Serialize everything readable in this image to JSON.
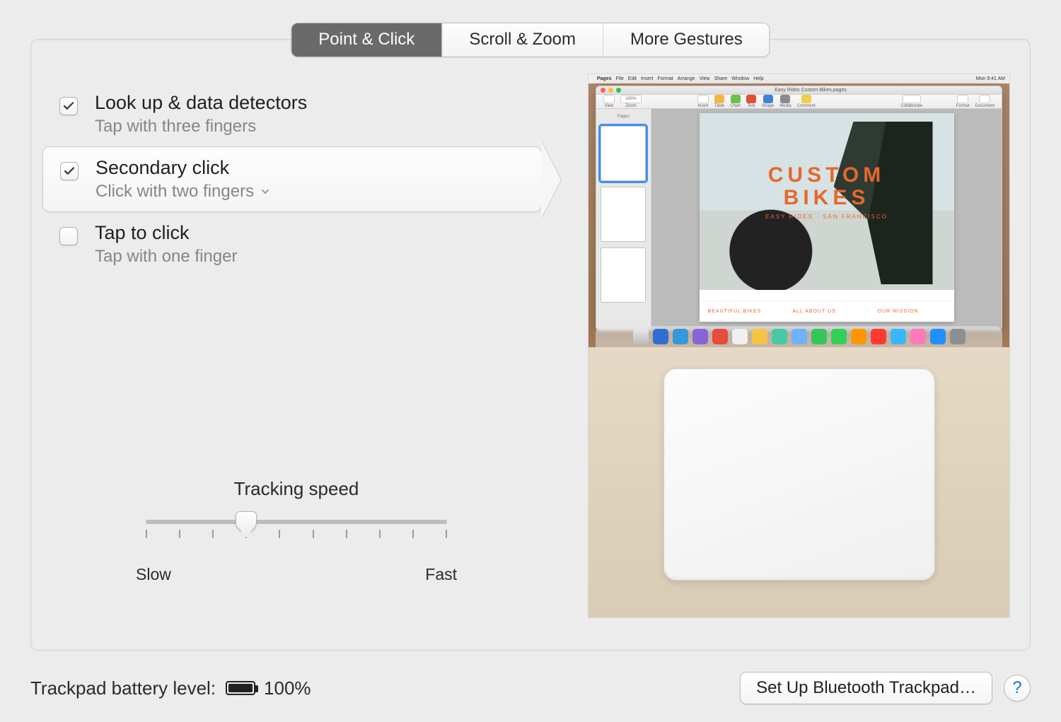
{
  "tabs": {
    "point": "Point & Click",
    "scroll": "Scroll & Zoom",
    "gestures": "More Gestures"
  },
  "options": {
    "lookup": {
      "title": "Look up & data detectors",
      "sub": "Tap with three fingers",
      "checked": true
    },
    "secondary": {
      "title": "Secondary click",
      "sub": "Click with two fingers",
      "checked": true
    },
    "tap": {
      "title": "Tap to click",
      "sub": "Tap with one finger",
      "checked": false
    }
  },
  "tracking": {
    "label": "Tracking speed",
    "slow": "Slow",
    "fast": "Fast",
    "ticks": 10,
    "value_index": 3
  },
  "preview": {
    "menubar": {
      "app": "Pages",
      "menus": [
        "File",
        "Edit",
        "Insert",
        "Format",
        "Arrange",
        "View",
        "Share",
        "Window",
        "Help"
      ],
      "clock": "Mon 9:41 AM"
    },
    "window_title": "Easy Rides Custom Bikes.pages",
    "toolbar": {
      "view": "View",
      "zoom_value": "100%",
      "zoom": "Zoom",
      "insert": "Insert",
      "table": "Table",
      "chart": "Chart",
      "text": "Text",
      "shape": "Shape",
      "media": "Media",
      "comment": "Comment",
      "collaborate": "Collaborate",
      "format": "Format",
      "document": "Document"
    },
    "sidebar_label": "Pages",
    "hero_line1": "CUSTOM",
    "hero_line2": "BIKES",
    "hero_sub": "EASY RIDES · SAN FRANCISCO",
    "footer_cols": [
      "BEAUTIFUL BIKES",
      "ALL ABOUT US",
      "OUR MISSION"
    ]
  },
  "footer": {
    "battery_label": "Trackpad battery level:",
    "battery_value": "100%",
    "setup_btn": "Set Up Bluetooth Trackpad…",
    "help": "?"
  }
}
